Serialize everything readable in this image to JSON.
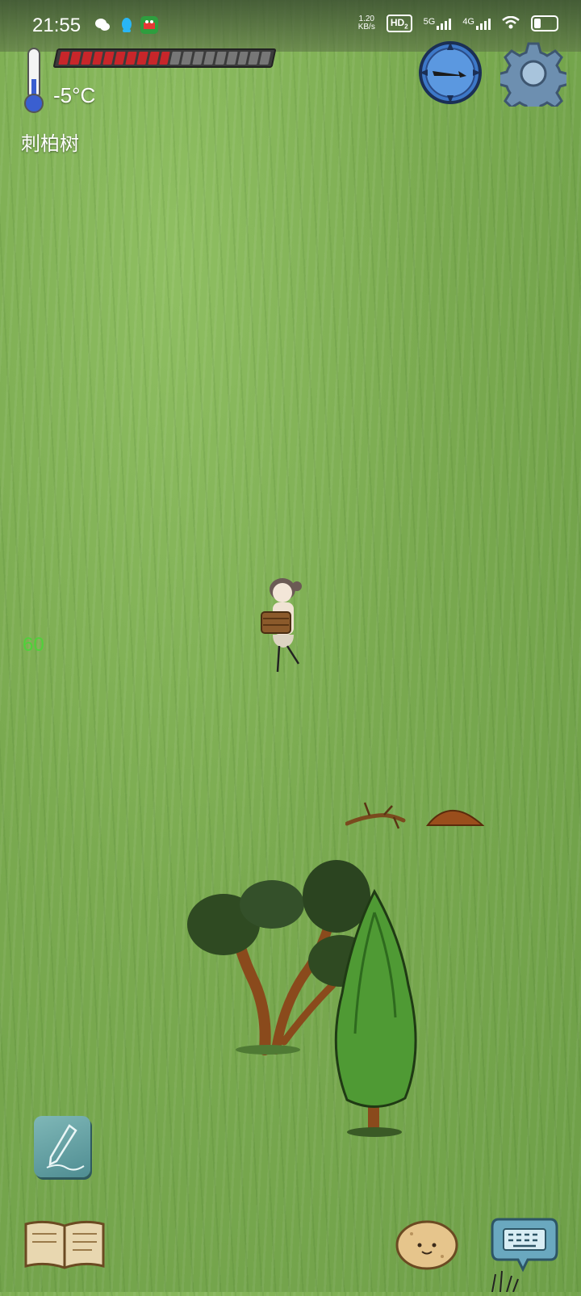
{
  "status_bar": {
    "time": "21:55",
    "net_speed_value": "1.20",
    "net_speed_unit": "KB/s",
    "hd_badge": "HD",
    "hd_sub": "2",
    "network_1": "5G",
    "network_2": "4G",
    "apps": [
      "wechat-icon",
      "qq-icon",
      "game-app-icon"
    ]
  },
  "hud": {
    "temperature": "-5°C",
    "location_name": "刺柏树",
    "health": {
      "filled_segments": 10,
      "total_segments": 19
    },
    "fps": "60"
  },
  "colors": {
    "grass": "#7aaa50",
    "health_fill": "#c8262a",
    "health_empty": "#777777",
    "fps_text": "#4ed23a"
  },
  "icons": [
    "thermometer-icon",
    "compass-icon",
    "gear-icon",
    "pencil-icon",
    "book-icon",
    "potato-face-icon",
    "keyboard-icon"
  ]
}
